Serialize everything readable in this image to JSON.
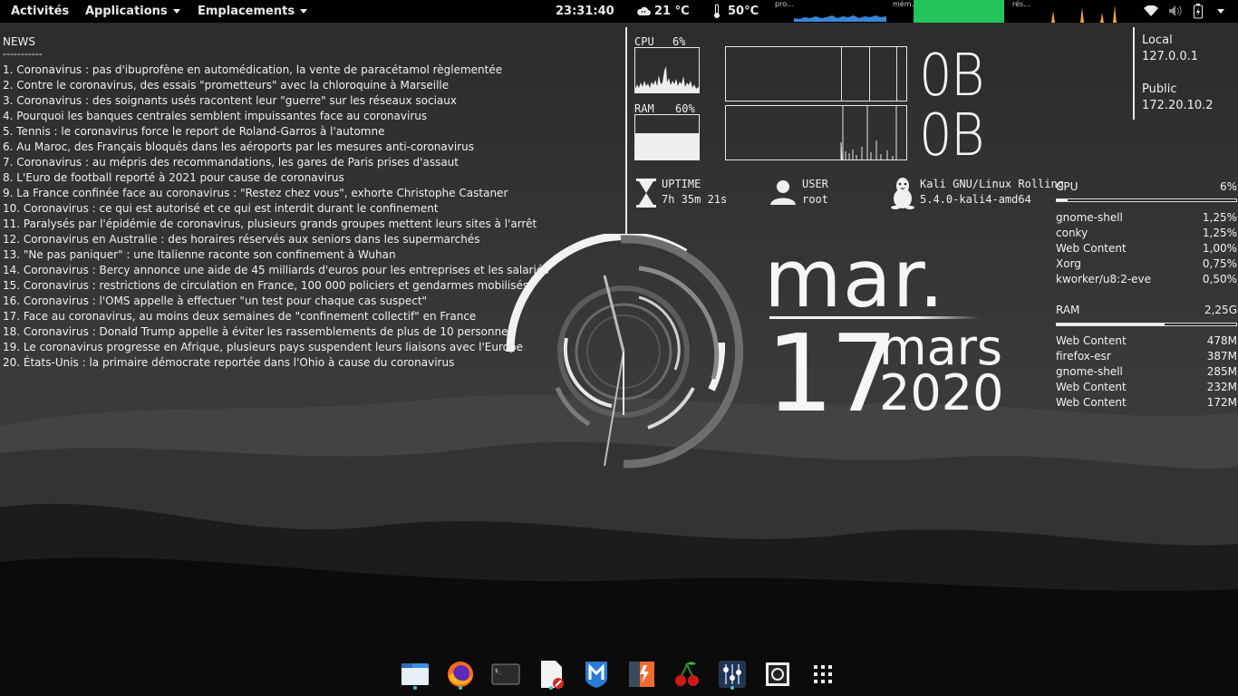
{
  "topbar": {
    "activities": "Activités",
    "applications": "Applications",
    "places": "Emplacements",
    "clock": "23:31:40",
    "weather": "21 °C",
    "temperature": "50°C",
    "proc_label": "pro...",
    "mem_label": "mém.",
    "net_label": "rés..."
  },
  "news": {
    "title": "NEWS",
    "separator": "-----------",
    "items": [
      "1. Coronavirus : pas d'ibuprofène en automédication, la vente de paracétamol règlementée",
      "2. Contre le coronavirus, des essais \"prometteurs\" avec la chloroquine à Marseille",
      "3. Coronavirus : des soignants usés racontent leur \"guerre\" sur les réseaux sociaux",
      "4. Pourquoi les banques centrales semblent impuissantes face au coronavirus",
      "5. Tennis : le coronavirus force le report de Roland-Garros à l'automne",
      "6. Au Maroc, des Français bloqués dans les aéroports par les mesures anti-coronavirus",
      "7. Coronavirus : au mépris des recommandations, les gares de Paris prises d'assaut",
      "8. L'Euro de football reporté à 2021 pour cause de coronavirus",
      "9. La France confinée face au coronavirus : \"Restez chez vous\", exhorte Christophe Castaner",
      "10. Coronavirus : ce qui est autorisé et ce qui est interdit durant le confinement",
      "11. Paralysés par l'épidémie de coronavirus, plusieurs grands groupes mettent leurs sites à l'arrêt",
      "12. Coronavirus en Australie : des horaires réservés aux seniors dans les supermarchés",
      "13. \"Ne pas paniquer\" : une Italienne raconte son confinement à Wuhan",
      "14. Coronavirus : Bercy annonce une aide de 45 milliards d'euros pour les entreprises et les salariés",
      "15. Coronavirus : restrictions de circulation en France, 100 000 policiers et gendarmes mobilisés",
      "16. Coronavirus : l'OMS appelle à effectuer \"un test pour chaque cas suspect\"",
      "17. Face au coronavirus, au moins deux semaines de \"confinement collectif\" en France",
      "18. Coronavirus : Donald Trump appelle à éviter les rassemblements de plus de 10 personnes",
      "19. Le coronavirus progresse en Afrique, plusieurs pays suspendent leurs liaisons avec l'Europe",
      "20. États-Unis : la primaire démocrate reportée dans l'Ohio à cause du coronavirus"
    ]
  },
  "system": {
    "cpu_label": "CPU",
    "cpu_value": "6%",
    "ram_label": "RAM",
    "ram_value": "60%",
    "net_up": "0B",
    "net_down": "0B",
    "uptime_label": "UPTIME",
    "uptime_value": "7h 35m 21s",
    "user_label": "USER",
    "user_value": "root",
    "os_name": "Kali GNU/Linux Rolling",
    "kernel": "5.4.0-kali4-amd64"
  },
  "network": {
    "local_label": "Local",
    "local_ip": "127.0.0.1",
    "public_label": "Public",
    "public_ip": "172.20.10.2"
  },
  "top_cpu": {
    "label": "CPU",
    "value": "6%",
    "fraction": 0.06,
    "processes": [
      {
        "name": "gnome-shell",
        "value": "1,25%"
      },
      {
        "name": "conky",
        "value": "1,25%"
      },
      {
        "name": "Web Content",
        "value": "1,00%"
      },
      {
        "name": "Xorg",
        "value": "0,75%"
      },
      {
        "name": "kworker/u8:2-eve",
        "value": "0,50%"
      }
    ]
  },
  "top_ram": {
    "label": "RAM",
    "value": "2,25G",
    "fraction": 0.6,
    "processes": [
      {
        "name": "Web Content",
        "value": "478M"
      },
      {
        "name": "firefox-esr",
        "value": "387M"
      },
      {
        "name": "gnome-shell",
        "value": "285M"
      },
      {
        "name": "Web Content",
        "value": "232M"
      },
      {
        "name": "Web Content",
        "value": "172M"
      }
    ]
  },
  "date": {
    "weekday": "mar.",
    "day": "17",
    "month": "mars",
    "year": "2020"
  },
  "dock": {
    "apps": [
      "files-icon",
      "firefox-icon",
      "terminal-icon",
      "text-editor-icon",
      "metasploit-icon",
      "burpsuite-icon",
      "cherrytree-icon",
      "settings-icon",
      "screenshot-icon",
      "show-apps-icon"
    ]
  },
  "colors": {
    "accent_teal": "#3fc9c0",
    "cpu_graph_blue": "#3a86d6",
    "mem_graph_green": "#22c45a",
    "net_graph_orange": "#f2a23a"
  }
}
